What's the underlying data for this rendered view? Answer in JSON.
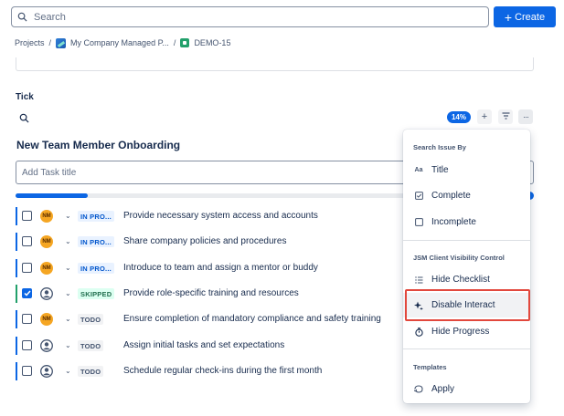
{
  "topbar": {
    "search_placeholder": "Search",
    "create_label": "Create",
    "create_icon": "plus-icon"
  },
  "breadcrumb": {
    "items": [
      "Projects",
      "My Company Managed P...",
      "DEMO-15"
    ],
    "separator": "/"
  },
  "checklist": {
    "section_label": "Tick",
    "progress_badge": "14%",
    "progress_fraction": 0.14,
    "toolbar_add": "+",
    "toolbar_more": "···",
    "list_title": "New Team Member Onboarding",
    "add_task_placeholder": "Add Task title",
    "tasks": [
      {
        "checked": false,
        "assignee": "NM",
        "status": "IN PRO...",
        "status_type": "inprog",
        "text": "Provide necessary system access and accounts"
      },
      {
        "checked": false,
        "assignee": "NM",
        "status": "IN PRO...",
        "status_type": "inprog",
        "text": "Share company policies and procedures"
      },
      {
        "checked": false,
        "assignee": "NM",
        "status": "IN PRO...",
        "status_type": "inprog",
        "text": "Introduce to team and assign a mentor or buddy"
      },
      {
        "checked": true,
        "assignee": "",
        "status": "SKIPPED",
        "status_type": "skipped",
        "text": "Provide role-specific training and resources"
      },
      {
        "checked": false,
        "assignee": "NM",
        "status": "TODO",
        "status_type": "todo",
        "text": "Ensure completion of mandatory compliance and safety training"
      },
      {
        "checked": false,
        "assignee": "",
        "status": "TODO",
        "status_type": "todo",
        "text": "Assign initial tasks and set expectations"
      },
      {
        "checked": false,
        "assignee": "",
        "status": "TODO",
        "status_type": "todo",
        "text": "Schedule regular check-ins during the first month"
      }
    ]
  },
  "menu": {
    "search_header": "Search Issue By",
    "search_items": [
      {
        "icon": "Aa",
        "label": "Title"
      },
      {
        "icon": "check-square-icon",
        "label": "Complete"
      },
      {
        "icon": "square-icon",
        "label": "Incomplete"
      }
    ],
    "visibility_header": "JSM Client Visibility Control",
    "visibility_items": [
      {
        "icon": "list-icon",
        "label": "Hide Checklist"
      },
      {
        "icon": "sparkle-icon",
        "label": "Disable Interact"
      },
      {
        "icon": "stopwatch-icon",
        "label": "Hide Progress"
      }
    ],
    "templates_header": "Templates",
    "templates_items": [
      {
        "icon": "apply-icon",
        "label": "Apply"
      }
    ]
  },
  "colors": {
    "accent": "#0c66e4",
    "highlight_frame": "#e2483d",
    "avatar": "#f5a623"
  }
}
